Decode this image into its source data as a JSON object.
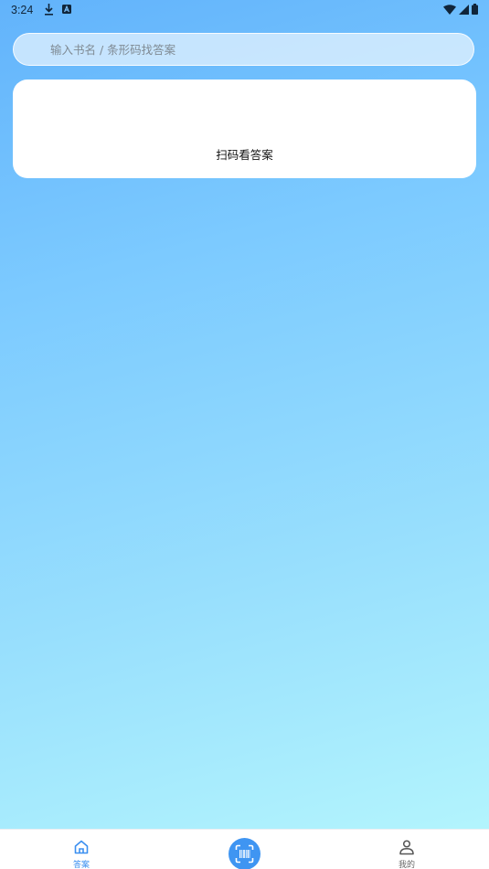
{
  "status_bar": {
    "time": "3:24",
    "icons": [
      "download-icon",
      "a-badge-icon",
      "wifi-icon",
      "signal-icon",
      "battery-icon"
    ]
  },
  "search": {
    "placeholder": "输入书名 / 条形码找答案",
    "value": ""
  },
  "scan_card": {
    "label": "扫码看答案"
  },
  "bottom_nav": {
    "items": [
      {
        "label": "答案",
        "icon": "home-icon",
        "active": true
      },
      {
        "label": "",
        "icon": "barcode-scan-icon",
        "active": false
      },
      {
        "label": "我的",
        "icon": "user-icon",
        "active": false
      }
    ]
  },
  "colors": {
    "gradient_top": "#62b3fb",
    "gradient_bottom": "#b6f7fd",
    "accent": "#3f95f2",
    "active_nav": "#3b8ff0",
    "inactive_nav": "#666666"
  }
}
